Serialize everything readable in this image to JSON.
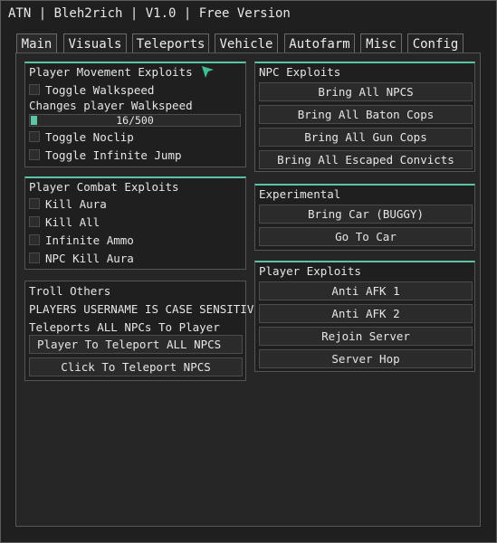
{
  "window": {
    "title": "ATN | Bleh2rich | V1.0 | Free Version"
  },
  "tabs": [
    "Main",
    "Visuals",
    "Teleports",
    "Vehicle",
    "Autofarm",
    "Misc",
    "Config"
  ],
  "player_movement": {
    "title": "Player Movement Exploits",
    "toggle_walkspeed": "Toggle Walkspeed",
    "walkspeed_label": "Changes player Walkspeed",
    "walkspeed_value": "16/500",
    "walkspeed_fraction": 0.032,
    "toggle_noclip": "Toggle Noclip",
    "toggle_infinite_jump": "Toggle Infinite Jump"
  },
  "player_combat": {
    "title": "Player Combat Exploits",
    "kill_aura": "Kill Aura",
    "kill_all": "Kill All",
    "infinite_ammo": "Infinite Ammo",
    "npc_kill_aura": "NPC Kill Aura"
  },
  "troll_others": {
    "title": "Troll Others",
    "case_note": "PLAYERS USERNAME IS CASE SENSITIVE",
    "teleport_note": "Teleports ALL NPCs To Player",
    "player_field": "Player To Teleport ALL NPCS",
    "click_button": "Click To Teleport NPCS"
  },
  "npc_exploits": {
    "title": "NPC Exploits",
    "buttons": [
      "Bring All NPCS",
      "Bring All Baton Cops",
      "Bring All Gun Cops",
      "Bring All Escaped Convicts"
    ]
  },
  "experimental": {
    "title": "Experimental",
    "buttons": [
      "Bring Car (BUGGY)",
      "Go To Car"
    ]
  },
  "player_exploits": {
    "title": "Player Exploits",
    "buttons": [
      "Anti AFK 1",
      "Anti AFK 2",
      "Rejoin Server",
      "Server Hop"
    ]
  },
  "colors": {
    "accent": "#5cc4a6",
    "background": "#1f1f1f"
  },
  "icons": {
    "cursor": "mouse-pointer-icon"
  }
}
